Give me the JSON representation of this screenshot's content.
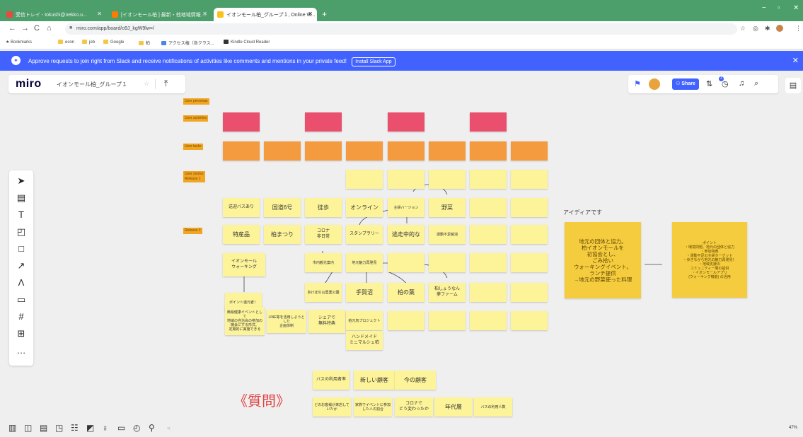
{
  "browser": {
    "tabs": [
      {
        "title": "受信トレイ - tokushi@nekko.u...",
        "fav_color": "#e84a3f"
      },
      {
        "title": "[イオンモール柏 ] 最新・他地域情報 ...",
        "fav_color": "#ff7a00"
      },
      {
        "title": "イオンモール柏_グループ１, Online W...",
        "fav_color": "#f6c21b"
      }
    ],
    "url": "miro.com/app/board/o9J_kgW9lw=/",
    "bookmarks": [
      "Bookmarks",
      "econ",
      "job",
      "Google",
      "柏",
      "アクセス権（各クラス...",
      "Kindle Cloud Reader"
    ]
  },
  "banner": {
    "text": "Approve requests to join right from Slack and receive notifications of activities like comments and mentions in your private feed!",
    "button": "Install Slack App"
  },
  "topbar": {
    "logo": "miro",
    "board_name": "イオンモール柏_グループ１",
    "share_label": "Share",
    "notif_count": "3"
  },
  "icons": {
    "board_star": "star-icon",
    "export": "upload-icon",
    "toolbar": [
      "cursor-icon",
      "template-icon",
      "text-icon",
      "sticky-note-icon",
      "shape-icon",
      "arrow-icon",
      "pen-icon",
      "comment-icon",
      "frame-icon",
      "upload-icon",
      "more-icon"
    ]
  },
  "zoom": "47%",
  "colors": {
    "pink": "#ea4f6e",
    "orange": "#f39b3e",
    "yellow": "#fdf49a",
    "accent": "#4262ff"
  },
  "board": {
    "row_labels": [
      "User personas",
      "User activities",
      "User tasks",
      "User stories\nRelease 1",
      "Release 2"
    ],
    "stickies": [
      "送迎バスあり",
      "国道6号",
      "徒歩",
      "オンライン",
      "主婦バージョン",
      "野菜",
      "特産品",
      "柏まつり",
      "コロナ\n非日常",
      "スタンプラリー",
      "逃走中的な",
      "運動不足解消",
      "イオンモール\nウォーキング",
      "市内観光案内",
      "地元魅力再発見",
      "ポイント還元者！",
      "あけぼの山農業公園",
      "手賀沼",
      "柏の葉",
      "柏しょうなん\n夢ファーム",
      "簡易健康イベントとして\n地域の自治会の参加の\n機会にする形式、\n定期的に実施できる",
      "LINE等を活用しようとした\n企画体制",
      "シェアで\n無料特典",
      "柏元気プロジェクト",
      "ハンドメイド\nミニマルシェ柏",
      "バスの利用者率",
      "新しい顧客",
      "今の顧客",
      "どのお客様が来店していたか",
      "家族でイベントに参加した人の割合",
      "コロナで\nどう変わったか",
      "年代層",
      "バスの利用人数"
    ],
    "idea_label": "アイディアです",
    "idea_note": "地元の団体と協力。\n柏イオンモールを\n初協会とし、\nごみ拾い\nウォーキングイベント。\nランチ提供\n→地元の野菜使った料理",
    "idea_points": "ポイント\n・環境問題、地元の団体と協力\n・参加特典\n・運動不足の主婦ターゲット\n・歩きながら地元の魅力再発見！\n・地域支援の\nコミュニティー場の提供\n・イオンモールアプリ\n(ウォーキング機能) の活用",
    "question": "《質問》"
  }
}
